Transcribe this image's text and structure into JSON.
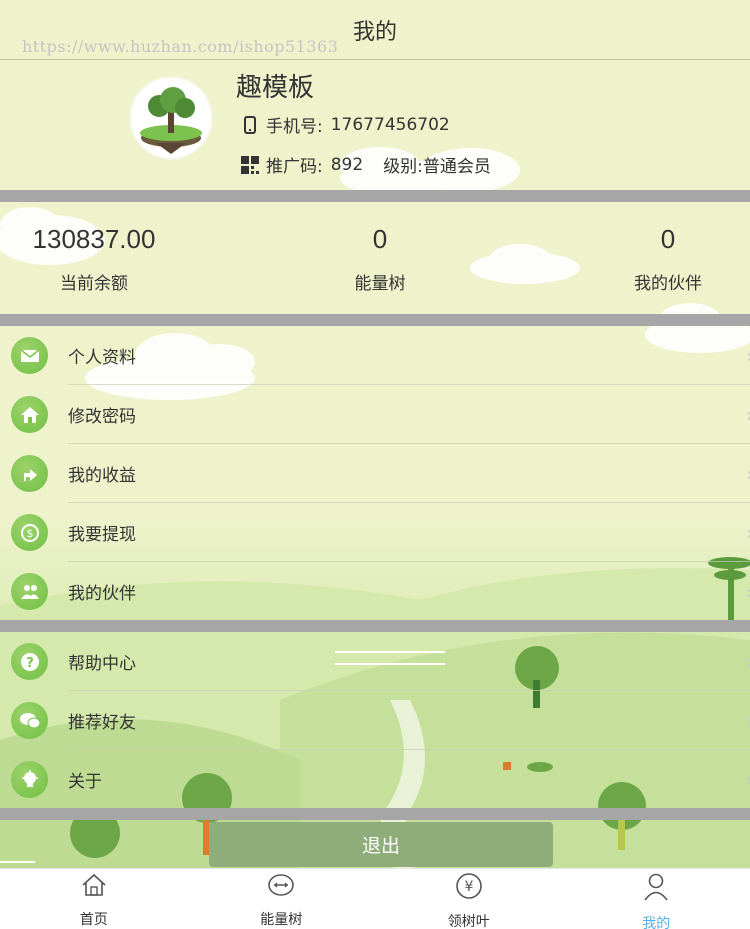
{
  "header": {
    "title": "我的",
    "watermark": "https://www.huzhan.com/ishop51363"
  },
  "profile": {
    "name": "趣模板",
    "phone_label": "手机号:",
    "phone": "17677456702",
    "code_label": "推广码:",
    "code": "892",
    "level": "级别:普通会员"
  },
  "stats": [
    {
      "value": "130837.00",
      "label": "当前余额"
    },
    {
      "value": "0",
      "label": "能量树"
    },
    {
      "value": "0",
      "label": "我的伙伴"
    }
  ],
  "menu1": [
    {
      "label": "个人资料",
      "icon": "mail-icon"
    },
    {
      "label": "修改密码",
      "icon": "home-icon"
    },
    {
      "label": "我的收益",
      "icon": "share-icon"
    },
    {
      "label": "我要提现",
      "icon": "coin-icon"
    },
    {
      "label": "我的伙伴",
      "icon": "people-icon"
    }
  ],
  "menu2": [
    {
      "label": "帮助中心",
      "icon": "question-icon"
    },
    {
      "label": "推荐好友",
      "icon": "chat-icon"
    },
    {
      "label": "关于",
      "icon": "bulb-icon"
    }
  ],
  "arrow": "›",
  "logout_label": "退出",
  "tabs": [
    {
      "label": "首页",
      "icon": "home-icon"
    },
    {
      "label": "能量树",
      "icon": "energy-icon"
    },
    {
      "label": "领树叶",
      "icon": "yen-icon"
    },
    {
      "label": "我的",
      "icon": "user-icon",
      "active": true
    }
  ],
  "colors": {
    "accent": "#5ab1e6",
    "separator": "#a6a6a6",
    "logout": "#8fad7a",
    "icon_green": "#7cc24e"
  }
}
